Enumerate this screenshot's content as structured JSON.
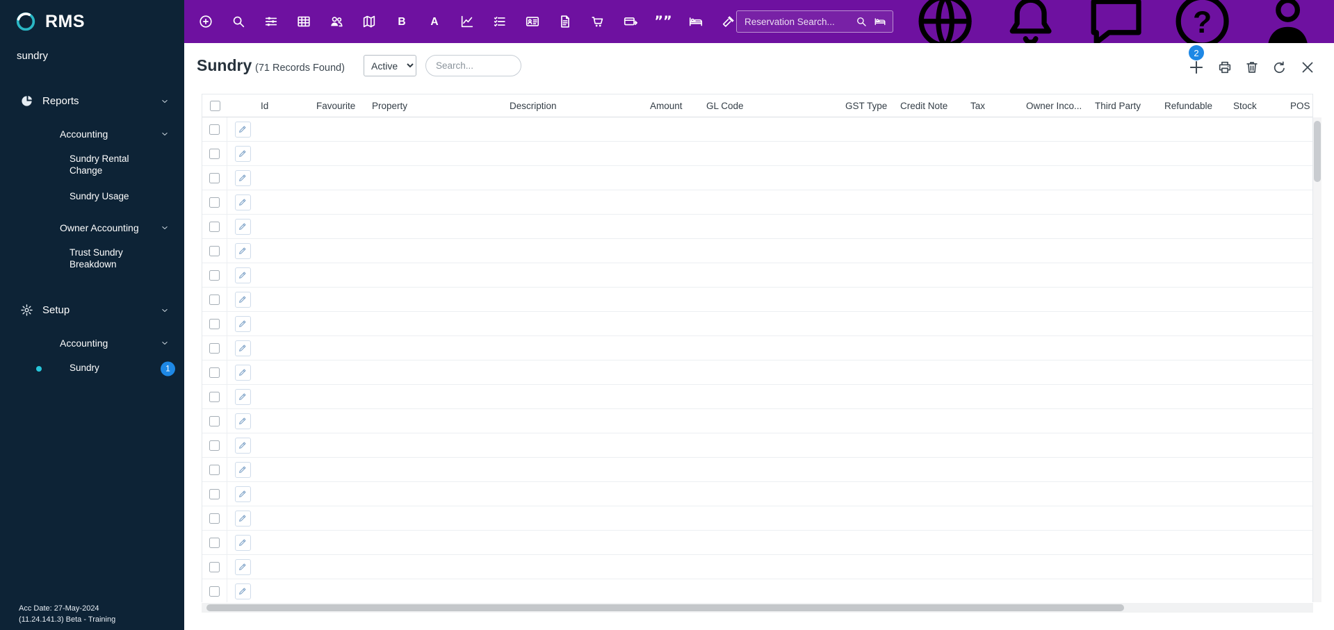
{
  "brand": {
    "name": "RMS"
  },
  "sidebar": {
    "menu_search_value": "sundry",
    "tree": [
      {
        "label": "Reports",
        "icon": "pie-chart",
        "expanded": true,
        "children": [
          {
            "label": "Accounting",
            "expanded": true,
            "children": [
              {
                "label": "Sundry Rental Change"
              },
              {
                "label": "Sundry Usage"
              }
            ]
          },
          {
            "label": "Owner Accounting",
            "expanded": true,
            "children": [
              {
                "label": "Trust Sundry Breakdown"
              }
            ]
          }
        ]
      },
      {
        "label": "Setup",
        "icon": "gear",
        "expanded": true,
        "children": [
          {
            "label": "Accounting",
            "expanded": true,
            "children": [
              {
                "label": "Sundry",
                "active": true,
                "badge": "1"
              }
            ]
          }
        ]
      }
    ],
    "footer_line1": "Acc Date: 27-May-2024",
    "footer_line2": "(11.24.141.3)  Beta - Training"
  },
  "topbar": {
    "icons": [
      "add-circle",
      "search",
      "filters",
      "booking-chart",
      "guests",
      "map",
      "letter-b",
      "letter-a",
      "line-chart",
      "checklist",
      "id-card",
      "report",
      "cart",
      "payment",
      "quotes",
      "bed",
      "tools"
    ],
    "reservation_search": {
      "placeholder": "Reservation Search...",
      "icons": [
        "search",
        "bed"
      ]
    },
    "right_icons": [
      "globe",
      "bell",
      "chat",
      "help",
      "person"
    ]
  },
  "page": {
    "title": "Sundry",
    "records_found": "(71 Records Found)",
    "filter_value": "Active",
    "search_placeholder": "Search...",
    "add_badge_count": "2",
    "action_icons": [
      "plus",
      "printer",
      "trash",
      "refresh",
      "close"
    ]
  },
  "table": {
    "columns": [
      "Id",
      "Favourite",
      "Property",
      "Description",
      "Amount",
      "GL Code",
      "GST Type",
      "Credit Note",
      "Tax",
      "Owner Inco...",
      "Third Party",
      "Refundable",
      "Stock",
      "POS"
    ],
    "visible_rows": 20
  },
  "colors": {
    "topbar": "#6e11a0",
    "sidebar": "#0d2336",
    "badge_blue": "#1e88e5",
    "active_dot": "#26c6da"
  }
}
